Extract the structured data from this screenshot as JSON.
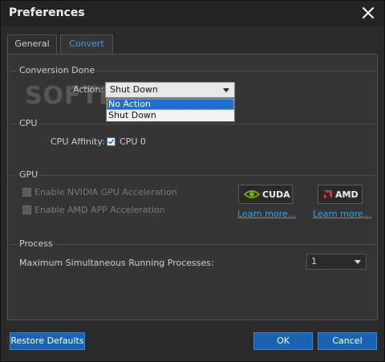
{
  "window": {
    "title": "Preferences"
  },
  "tabs": [
    {
      "label": "General"
    },
    {
      "label": "Convert"
    }
  ],
  "conversion": {
    "section_label": "Conversion Done",
    "action_label": "Action:",
    "action_value": "Shut Down",
    "options": [
      "No Action",
      "Shut Down"
    ],
    "highlighted_option": "No Action"
  },
  "watermark": "SOFTPEDIA",
  "cpu": {
    "section_label": "CPU",
    "affinity_label": "CPU Affinity:",
    "cpu0_label": "CPU 0",
    "cpu0_checked": true
  },
  "gpu": {
    "section_label": "GPU",
    "nvidia_label": "Enable NVIDIA GPU Acceleration",
    "amd_label": "Enable AMD APP Acceleration",
    "cuda_label": "CUDA",
    "amd_button_label": "AMD",
    "learn_more_1": "Learn more...",
    "learn_more_2": "Learn more..."
  },
  "process": {
    "section_label": "Process",
    "max_label": "Maximum Simultaneous Running Processes:",
    "max_value": "1"
  },
  "buttons": {
    "restore": "Restore Defaults",
    "ok": "OK",
    "cancel": "Cancel"
  },
  "colors": {
    "accent": "#3aa0e8",
    "button": "#1a63b2",
    "nvidia": "#76b900",
    "amd": "#e0322e"
  }
}
